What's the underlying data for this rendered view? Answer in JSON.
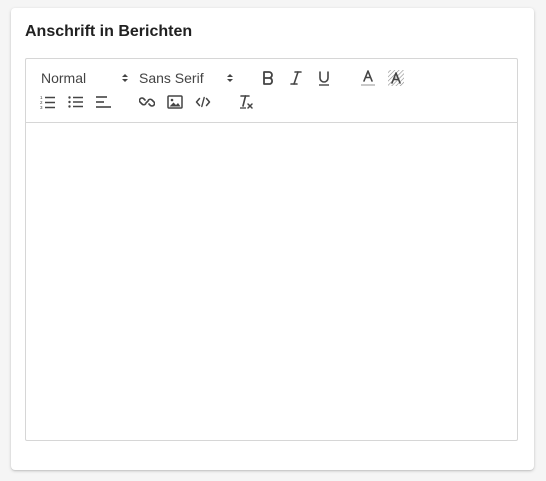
{
  "section": {
    "title": "Anschrift in Berichten"
  },
  "toolbar": {
    "header_picker": {
      "selected": "Normal",
      "icon": "chevron-updown-icon"
    },
    "font_picker": {
      "selected": "Sans Serif",
      "icon": "chevron-updown-icon"
    },
    "buttons": [
      {
        "name": "bold",
        "icon": "bold-icon"
      },
      {
        "name": "italic",
        "icon": "italic-icon"
      },
      {
        "name": "underline",
        "icon": "underline-icon"
      },
      {
        "name": "text-color",
        "icon": "text-color-icon"
      },
      {
        "name": "background-color",
        "icon": "background-color-icon"
      },
      {
        "name": "ordered-list",
        "icon": "ordered-list-icon"
      },
      {
        "name": "bullet-list",
        "icon": "bullet-list-icon"
      },
      {
        "name": "align",
        "icon": "align-left-icon"
      },
      {
        "name": "link",
        "icon": "link-icon"
      },
      {
        "name": "image",
        "icon": "image-icon"
      },
      {
        "name": "code-block",
        "icon": "code-icon"
      },
      {
        "name": "clear-formatting",
        "icon": "clear-format-icon"
      }
    ]
  },
  "editor": {
    "content": ""
  },
  "colors": {
    "icon_stroke": "#444444",
    "border": "#d6d6d6",
    "title_text": "#212121"
  }
}
